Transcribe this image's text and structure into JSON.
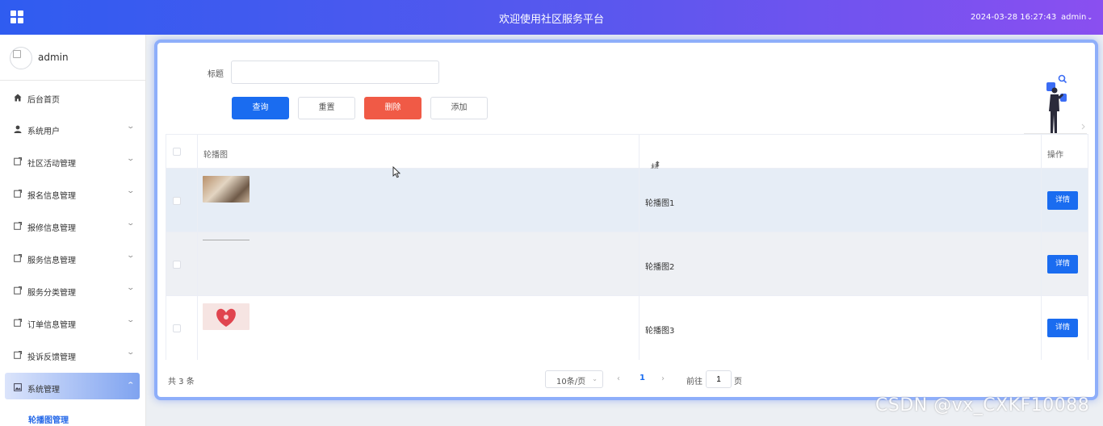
{
  "header": {
    "title": "欢迎使用社区服务平台",
    "datetime": "2024-03-28 16:27:43",
    "user": "admin"
  },
  "sidebar": {
    "profile_name": "admin",
    "items": [
      {
        "label": "后台首页",
        "icon": "home-icon"
      },
      {
        "label": "系统用户",
        "icon": "user-icon"
      },
      {
        "label": "社区活动管理",
        "icon": "document-icon"
      },
      {
        "label": "报名信息管理",
        "icon": "document-icon"
      },
      {
        "label": "报修信息管理",
        "icon": "document-icon"
      },
      {
        "label": "服务信息管理",
        "icon": "document-icon"
      },
      {
        "label": "服务分类管理",
        "icon": "document-icon"
      },
      {
        "label": "订单信息管理",
        "icon": "document-icon"
      },
      {
        "label": "投诉反馈管理",
        "icon": "document-icon"
      },
      {
        "label": "系统管理",
        "icon": "image-icon"
      }
    ],
    "active_sub_item": "轮播图管理"
  },
  "search": {
    "label": "标题",
    "value": "",
    "placeholder": ""
  },
  "toolbar": {
    "query": "查询",
    "reset": "重置",
    "delete": "删除",
    "add": "添加"
  },
  "table": {
    "columns": {
      "image": "轮播图",
      "title": "标题",
      "actions": "操作"
    },
    "rows": [
      {
        "title": "轮播图1",
        "action": "详情"
      },
      {
        "title": "轮播图2",
        "action": "详情"
      },
      {
        "title": "轮播图3",
        "action": "详情"
      }
    ]
  },
  "pagination": {
    "total": "共 3 条",
    "page_size": "10条/页",
    "current_page": "1",
    "goto_label": "前往",
    "goto_value": "1",
    "goto_suffix": "页"
  },
  "watermark": "CSDN @vx_CXKF10088",
  "colors": {
    "primary": "#1a6cf0",
    "danger": "#f05a46",
    "header_start": "#2f5cf0",
    "header_end": "#8a4ff0"
  }
}
